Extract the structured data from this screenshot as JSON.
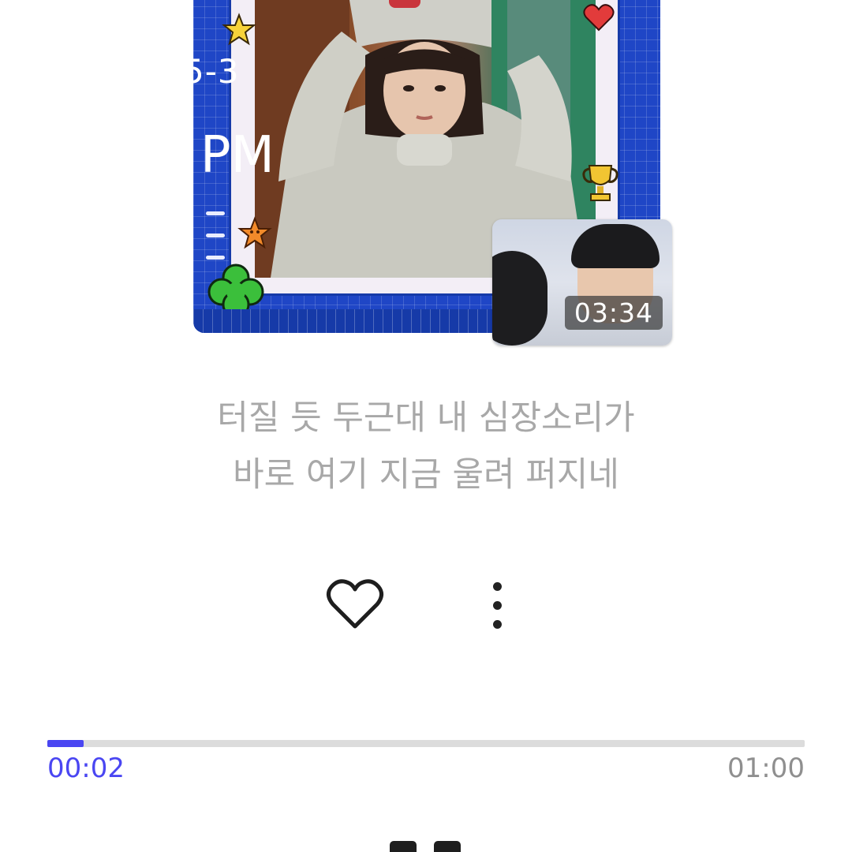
{
  "overlay_clock": {
    "date_fragment": "5-3",
    "ampm": "PM"
  },
  "album_art": {
    "description_icons": [
      "star-icon",
      "heart-icon",
      "trophy-icon",
      "clover-icon",
      "smiley-star-icon"
    ]
  },
  "video_thumbnail": {
    "duration": "03:34"
  },
  "lyrics": {
    "line1": "터질 듯 두근대 내 심장소리가",
    "line2": "바로 여기 지금 울려 퍼지네"
  },
  "actions": {
    "like_icon": "heart-outline-icon",
    "more_icon": "more-vertical-icon"
  },
  "playback": {
    "elapsed": "00:02",
    "total": "01:00",
    "progress_fraction": 0.048,
    "control_icon": "pause-icon"
  },
  "colors": {
    "accent": "#4a46f2",
    "album_frame_blue": "#1f46c6",
    "lyrics_gray": "#a8a8a8"
  }
}
